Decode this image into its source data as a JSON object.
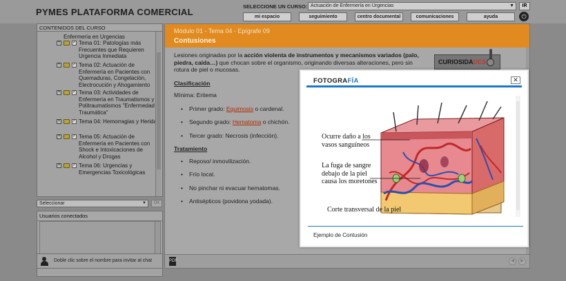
{
  "header": {
    "brand": "PYMES PLATAFORMA COMERCIAL",
    "course_label": "SELECCIONE UN CURSO:",
    "course_selected": "Actuación de Enfermería en Urgencias",
    "go_label": "IR",
    "nav": [
      {
        "label": "mi espacio"
      },
      {
        "label": "seguimiento"
      },
      {
        "label": "centro documental"
      },
      {
        "label": "comunicaciones"
      },
      {
        "label": "ayuda"
      }
    ]
  },
  "sidebar": {
    "title": "CONTENIDOS DEL CURSO",
    "top_item": "Enfermería en Urgencias",
    "items": [
      {
        "label": "Tema 01: Patologías más Frecuentes que Requieren Urgencia Inmediata"
      },
      {
        "label": "Tema 02: Actuación de Enfermería en Pacientes con Quemaduras, Congelación, Electrocución y Ahogamiento"
      },
      {
        "label": "Tema 03: Actividades de Enfermería en Traumatismos y Politraumatismos \"Enfermedad Traumática\""
      },
      {
        "label": "Tema 04: Hemorragias y Heridas"
      },
      {
        "label": "Tema 05: Actuación de Enfermería en Pacientes con Shock e Intoxicaciones de Alcohol y Drogas"
      },
      {
        "label": "Tema 06: Urgencias y Emergencias Toxicológicas"
      }
    ],
    "select_label": "Seleccionar",
    "ok_label": "OK",
    "users_title": "Usuarios conectados",
    "chat_hint": "Doble clic sobre el nombre para invitar al chat"
  },
  "main": {
    "breadcrumb": "Módulo 01 - Tema 04 - Epígrafe 09",
    "title": "Contusiones",
    "intro_pre": "Lesiones originadas por la ",
    "intro_bold": "acción violenta de instrumentos y mecanismos variados (palo, piedra, caída…)",
    "intro_post": " que chocan sobre el organismo, originando diversas alteraciones, pero sin rotura de piel o mucosas.",
    "clasificacion_title": "Clasificación",
    "minima": "Mínima: Eritema",
    "grado1_pre": "Primer grado: ",
    "grado1_link": "Equimosis",
    "grado1_post": " o cardenal.",
    "grado2_pre": "Segundo grado: ",
    "grado2_link": "Hematoma",
    "grado2_post": " o chichón.",
    "grado3": "Tercer grado: Necrosis (infección).",
    "tratamiento_title": "Tratamiento",
    "tratamiento": [
      "Reposo/ inmovilización.",
      "Frío local.",
      "No pinchar ni evacuar hematomas.",
      "Antisépticos (povidona yodada)."
    ],
    "curiosidades_pre": "CURIOSIDA",
    "curiosidades_post": "DES",
    "pdf_label": "PDF"
  },
  "popup": {
    "title_pre": "FOTOGRA",
    "title_post": "FÍA",
    "close": "✕",
    "label_1": "Ocurre daño a los vasos sanguíneos",
    "label_2": "La fuga de sangre debajo de la piel causa los moretones",
    "label_3": "Corte transversal de la piel",
    "caption": "Ejemplo de Contusión"
  },
  "colors": {
    "accent_orange": "#e08a1f",
    "accent_blue": "#1b78c9",
    "link_red": "#b02a00"
  }
}
